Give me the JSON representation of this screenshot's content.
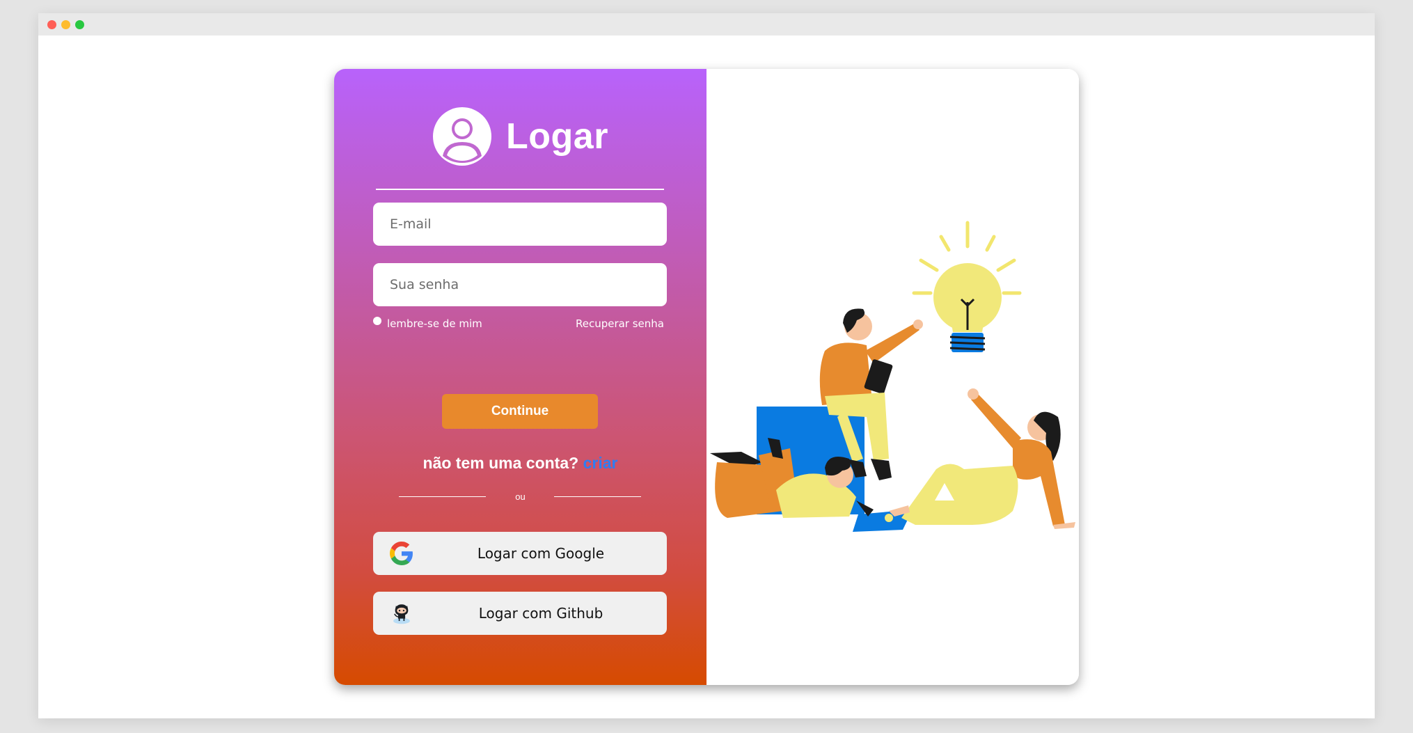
{
  "window": {
    "controls": [
      "close",
      "minimize",
      "maximize"
    ]
  },
  "login": {
    "title": "Logar",
    "email_placeholder": "E-mail",
    "password_placeholder": "Sua senha",
    "remember_label": "lembre-se de mim",
    "recover_label": "Recuperar senha",
    "continue_label": "Continue",
    "signup_prompt": "não tem uma conta?",
    "signup_link": "criar",
    "or_label": "ou",
    "google_label": "Logar com Google",
    "github_label": "Logar com Github"
  },
  "colors": {
    "gradient_top": "#b862fb",
    "gradient_bottom": "#d64b00",
    "continue_button": "#e8892c",
    "signup_link": "#2f7df2"
  },
  "icons": {
    "user": "user-circle-icon",
    "google": "google-icon",
    "github": "github-octocat-icon",
    "illustration": "team-idea-lightbulb-illustration"
  }
}
